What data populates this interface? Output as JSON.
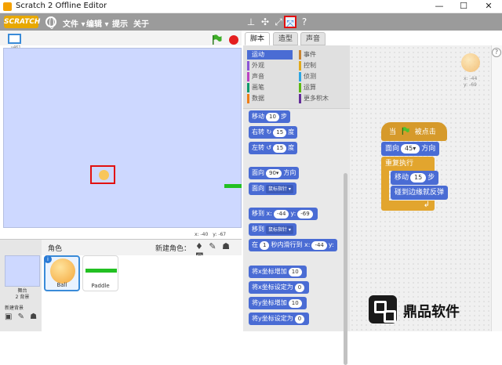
{
  "window": {
    "title": "Scratch 2 Offline Editor",
    "minimize_icon": "—",
    "maximize_icon": "☐",
    "close_icon": "✕"
  },
  "menubar": {
    "logo": "SCRATCH",
    "file": "文件 ▾",
    "edit": "编辑 ▾",
    "tips": "提示",
    "about": "关于",
    "tools": [
      "stamp-icon",
      "cut-icon",
      "grow-icon",
      "shrink-icon",
      "help-icon"
    ],
    "tool_glyphs": [
      "⊥",
      "✣",
      "⤢",
      "⤧",
      "?"
    ],
    "selected_tool": "shrink-icon"
  },
  "stage": {
    "version_label": "v461",
    "mouse_x": "x: -40",
    "mouse_y": "y: -67"
  },
  "tabs": [
    {
      "label": "脚本",
      "active": true
    },
    {
      "label": "造型",
      "active": false
    },
    {
      "label": "声音",
      "active": false
    }
  ],
  "categories": [
    {
      "label": "运动",
      "color": "#4a6cd4",
      "active": true
    },
    {
      "label": "外观",
      "color": "#8a55d7"
    },
    {
      "label": "声音",
      "color": "#bb42c3"
    },
    {
      "label": "画笔",
      "color": "#0e9a6c"
    },
    {
      "label": "数据",
      "color": "#ee7d16"
    },
    {
      "label": "事件",
      "color": "#c88330"
    },
    {
      "label": "控制",
      "color": "#e1a91a"
    },
    {
      "label": "侦测",
      "color": "#2ca5e2"
    },
    {
      "label": "运算",
      "color": "#5cb712"
    },
    {
      "label": "更多积木",
      "color": "#632d99"
    }
  ],
  "blocks": {
    "move": {
      "prefix": "移动",
      "value": "10",
      "suffix": "步"
    },
    "turn_right": {
      "prefix": "右转",
      "glyph": "↻",
      "value": "15",
      "suffix": "度"
    },
    "turn_left": {
      "prefix": "左转",
      "glyph": "↺",
      "value": "15",
      "suffix": "度"
    },
    "point_dir": {
      "prefix": "面向",
      "value": "90▾",
      "suffix": "方向"
    },
    "point_to": {
      "prefix": "面向",
      "dropdown": "鼠标指针 ▾"
    },
    "goto_xy": {
      "prefix": "移到",
      "x_label": "x:",
      "x": "-44",
      "y_label": "y:",
      "y": "-69"
    },
    "goto": {
      "prefix": "移到",
      "dropdown": "鼠标指针 ▾"
    },
    "glide": {
      "prefix": "在",
      "secs": "1",
      "mid": "秒内滑行到",
      "x_label": "x:",
      "x": "-44",
      "y_label": "y:"
    },
    "change_x": {
      "prefix": "将x坐标增加",
      "value": "10"
    },
    "set_x": {
      "prefix": "将x坐标设定为",
      "value": "0"
    },
    "change_y": {
      "prefix": "将y坐标增加",
      "value": "10"
    },
    "set_y": {
      "prefix": "将y坐标设定为",
      "value": "0"
    }
  },
  "script": {
    "hat_prefix": "当",
    "hat_suffix": "被点击",
    "point_prefix": "面向",
    "point_value": "45▾",
    "point_suffix": "方向",
    "forever_label": "重复执行",
    "move_prefix": "移动",
    "move_value": "15",
    "move_suffix": "步",
    "bounce_label": "碰到边缘就反弹",
    "loop_arrow": "↲"
  },
  "sprite_info": {
    "x": "x: -44",
    "y": "y: -69"
  },
  "sprites_pane": {
    "title": "角色",
    "new_sprite_label": "新建角色：",
    "new_sprite_icons": "♦ ✎ ☗ ◙",
    "stage_label_1": "舞台",
    "stage_label_2": "2 背景",
    "new_bg_label": "新建背景",
    "new_bg_icons": "▣ ✎ ☗ ◙",
    "sprites": [
      {
        "name": "Ball",
        "selected": true
      },
      {
        "name": "Paddle",
        "selected": false
      }
    ]
  },
  "watermark": {
    "text": "鼎品软件"
  },
  "help_label": "?"
}
